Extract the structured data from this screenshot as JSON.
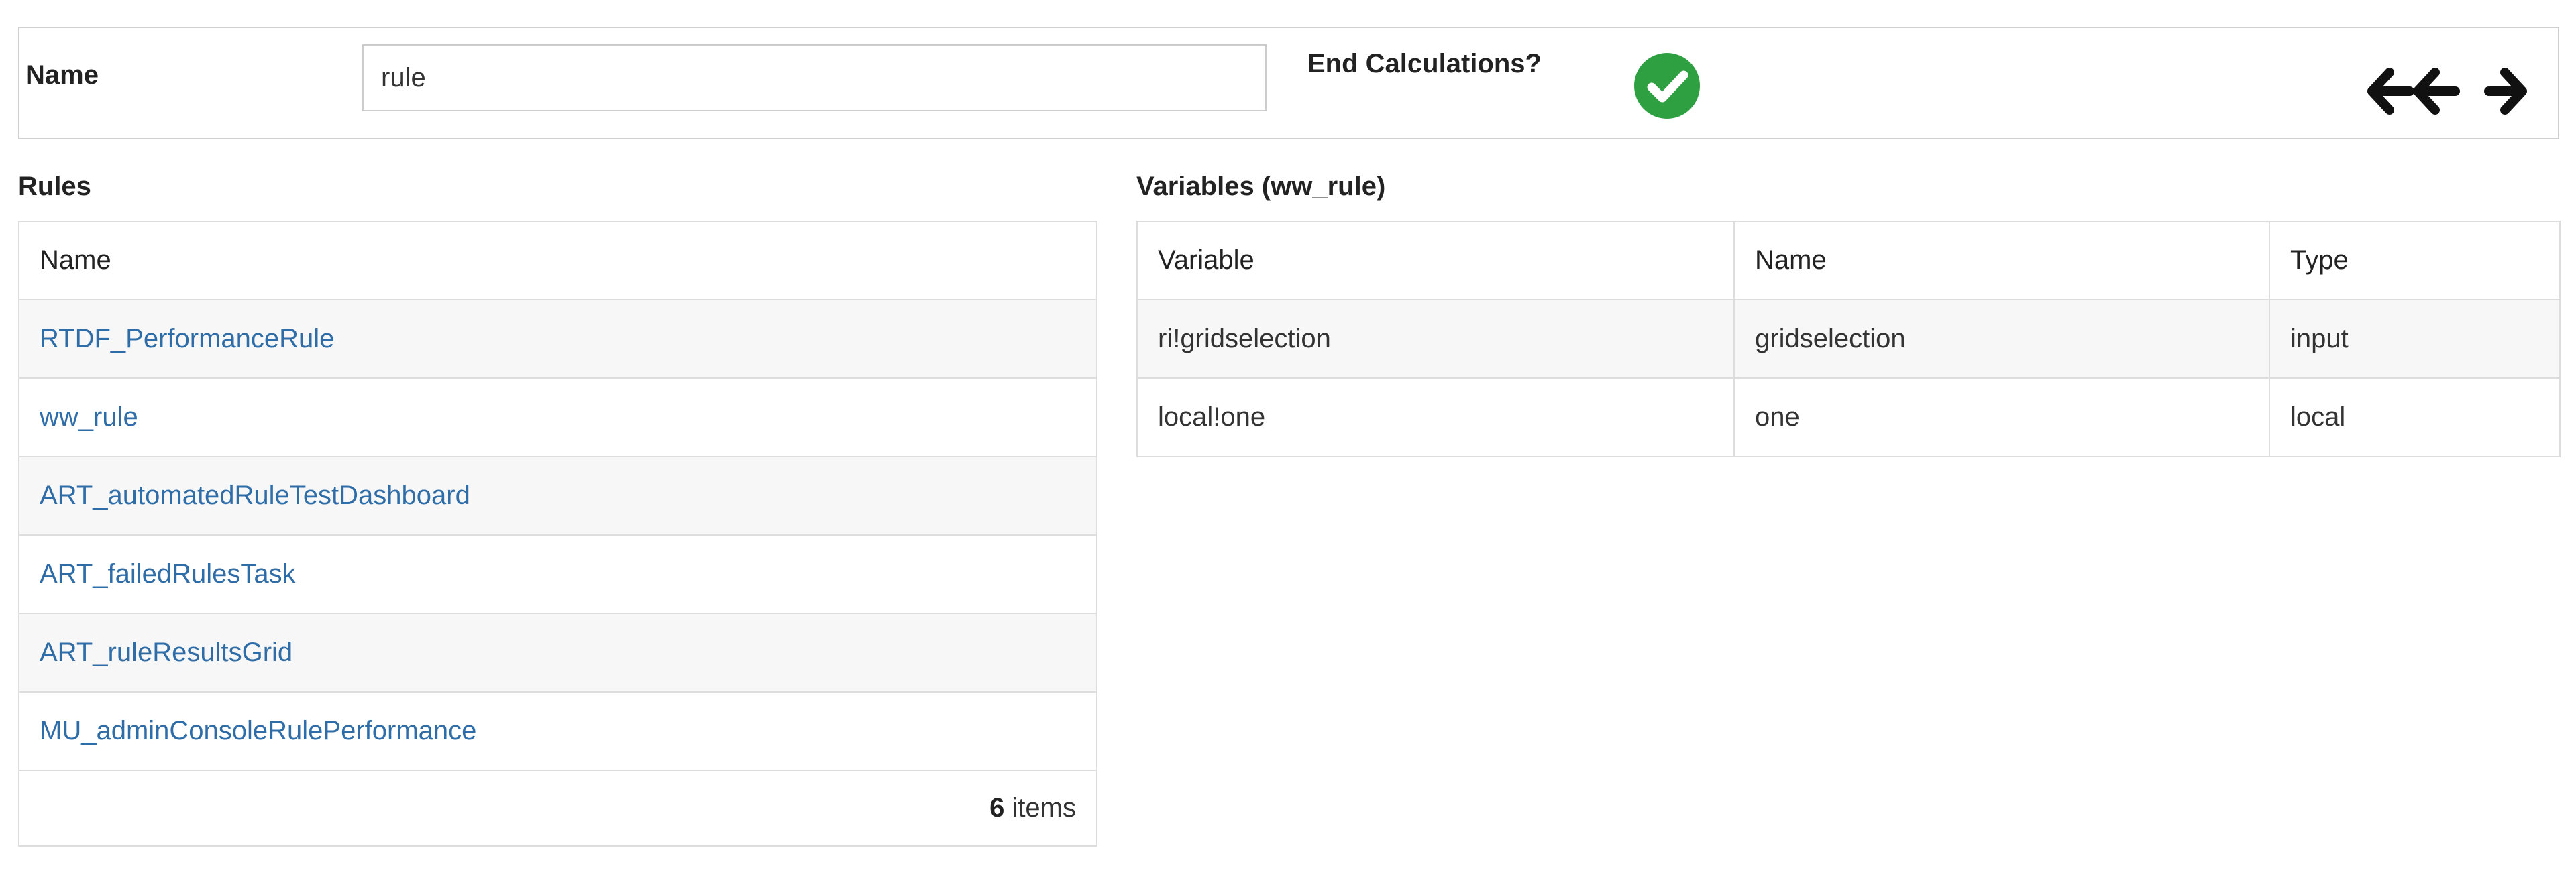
{
  "form": {
    "name_label": "Name",
    "name_value": "rule",
    "end_calc_label": "End Calculations?"
  },
  "icons": {
    "end_calc": "check-circle-icon",
    "back": "double-arrow-left-icon",
    "forward": "arrow-right-icon"
  },
  "colors": {
    "check_green": "#2fa042",
    "link_blue": "#2f6da8"
  },
  "rules": {
    "heading": "Rules",
    "columns": [
      "Name"
    ],
    "rows": [
      "RTDF_PerformanceRule",
      "ww_rule",
      "ART_automatedRuleTestDashboard",
      "ART_failedRulesTask",
      "ART_ruleResultsGrid",
      "MU_adminConsoleRulePerformance"
    ],
    "count": "6",
    "count_suffix": " items"
  },
  "variables": {
    "heading": "Variables (ww_rule)",
    "columns": [
      "Variable",
      "Name",
      "Type"
    ],
    "rows": [
      [
        "ri!gridselection",
        "gridselection",
        "input"
      ],
      [
        "local!one",
        "one",
        "local"
      ]
    ]
  }
}
